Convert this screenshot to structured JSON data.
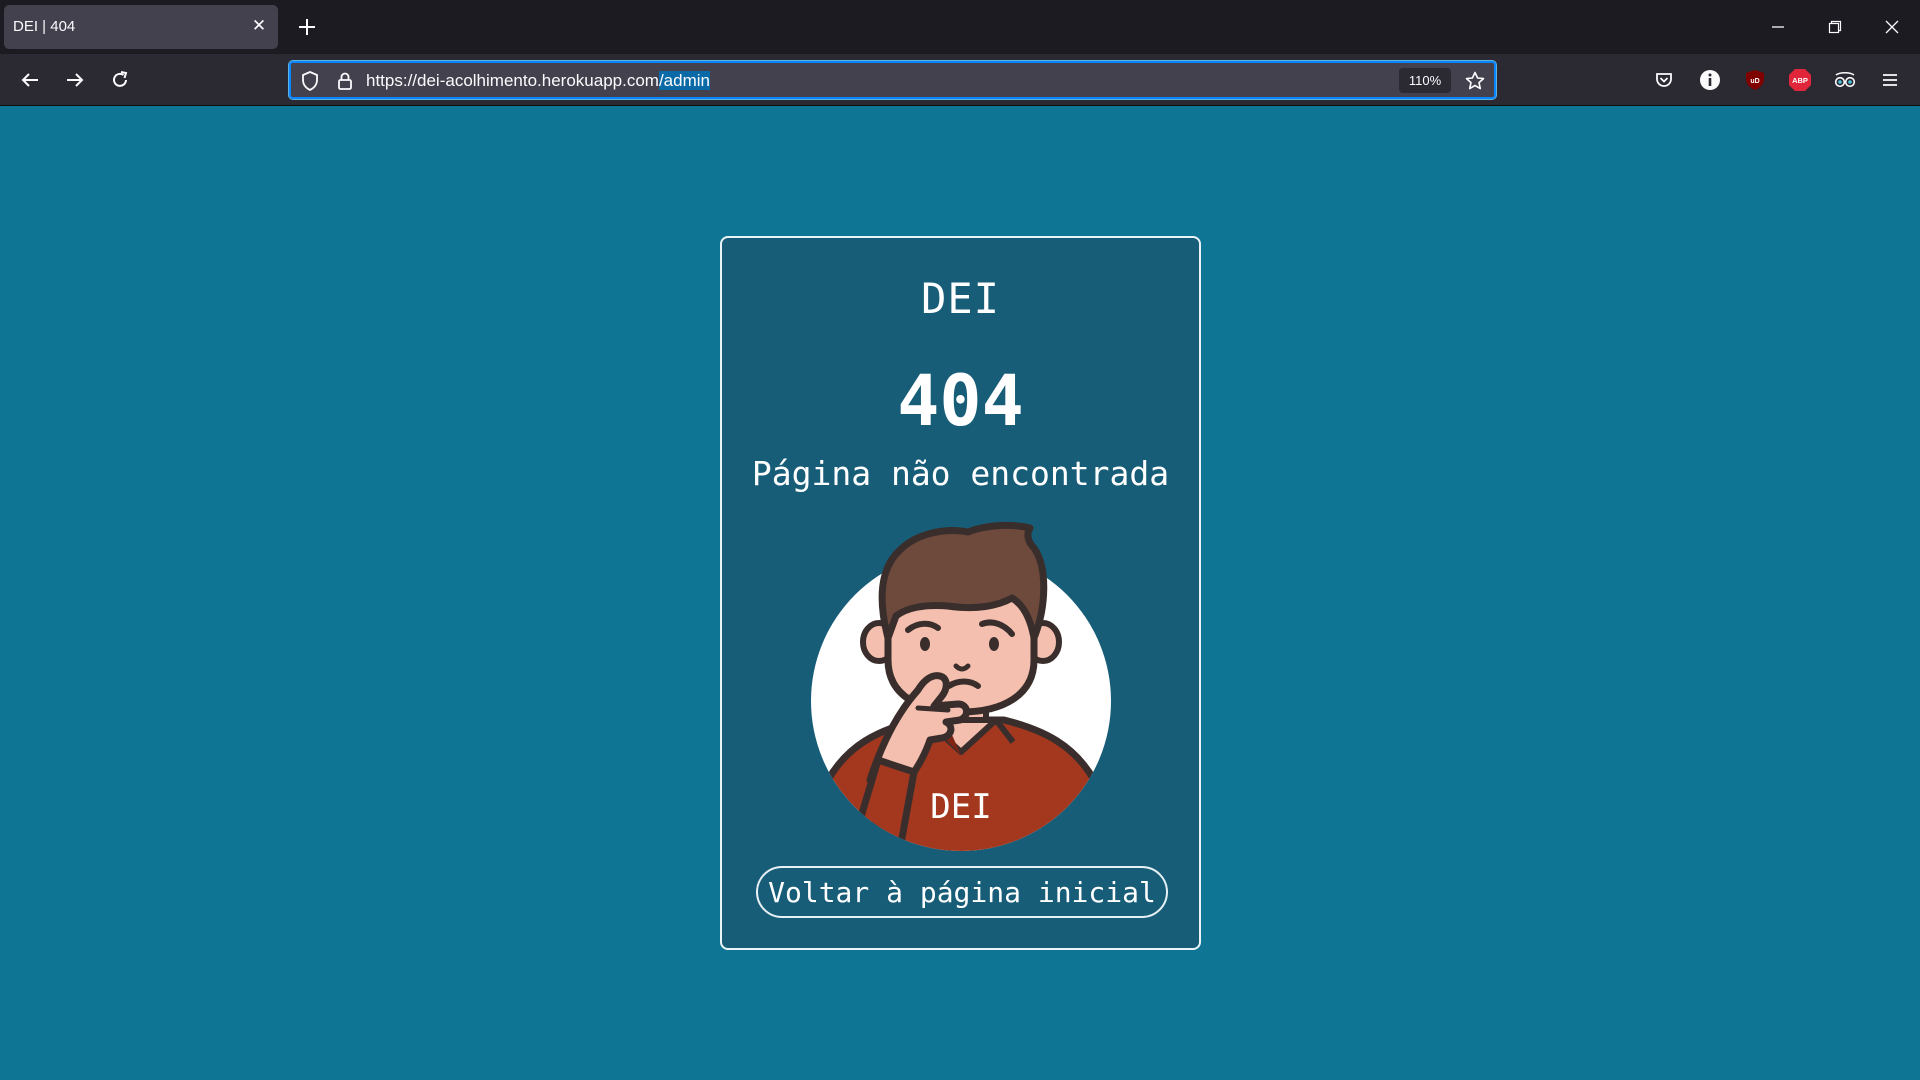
{
  "browser": {
    "tab": {
      "title": "DEI | 404"
    },
    "url": {
      "base": "https://dei-acolhimento.herokuapp.com",
      "path": "/admin"
    },
    "zoom": "110%",
    "extensions": [
      {
        "icon": "pocket-icon"
      },
      {
        "icon": "info-icon"
      },
      {
        "icon": "ublock-icon",
        "label": "uD"
      },
      {
        "icon": "adblock-plus-icon",
        "label": "ABP"
      },
      {
        "icon": "glasses-icon"
      },
      {
        "icon": "menu-icon"
      }
    ]
  },
  "page": {
    "brand": "DEI",
    "error_code": "404",
    "message": "Página não encontrada",
    "illustration_label": "DEI",
    "home_button": "Voltar à página inicial"
  },
  "colors": {
    "page_bg": "#0f7594",
    "card_bg": "#175d78",
    "shirt": "#a4381f",
    "skin": "#f4bfae",
    "hair": "#6e4a3c"
  }
}
